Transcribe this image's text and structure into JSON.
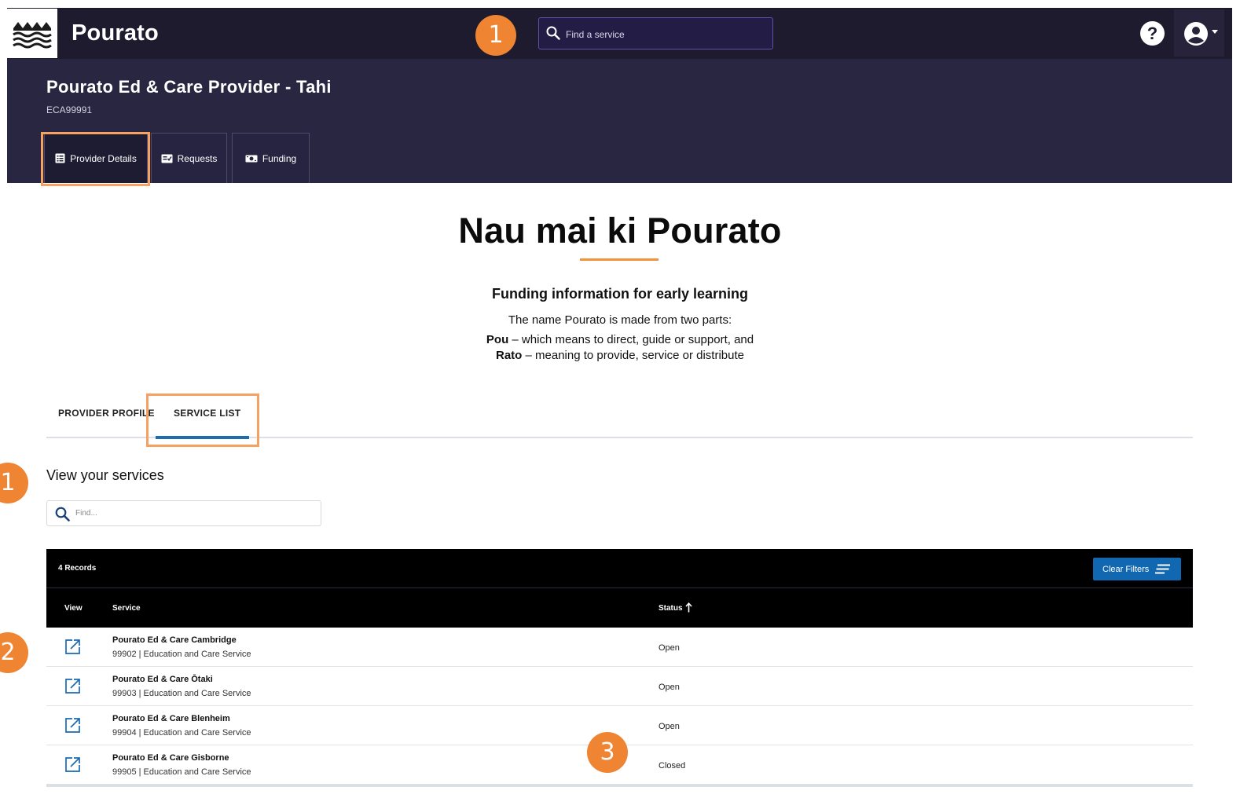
{
  "topbar": {
    "brand": "Pourato",
    "search_placeholder": "Find a service",
    "logo_icon": "waves-icon",
    "help_icon": "help-icon",
    "user_icon": "user-account-icon"
  },
  "provider": {
    "name": "Pourato Ed & Care Provider - Tahi",
    "id": "ECA99991",
    "tabs": [
      {
        "label": "Provider Details",
        "icon": "document-list-icon",
        "active": true
      },
      {
        "label": "Requests",
        "icon": "checklist-icon",
        "active": false
      },
      {
        "label": "Funding",
        "icon": "money-icon",
        "active": false
      }
    ]
  },
  "hero": {
    "title": "Nau mai ki Pourato",
    "subtitle": "Funding information for early learning",
    "intro": "The name Pourato is made from two parts:",
    "line1_bold": "Pou",
    "line1_rest": " – which means to direct, guide or support, and",
    "line2_bold": "Rato",
    "line2_rest": " – meaning to provide, service or distribute"
  },
  "content_tabs": [
    {
      "label": "PROVIDER PROFILE",
      "active": false
    },
    {
      "label": "SERVICE LIST",
      "active": true
    }
  ],
  "services": {
    "title": "View your services",
    "find_placeholder": "Find...",
    "record_count": "4 Records",
    "clear_filters": "Clear Filters",
    "columns": {
      "view": "View",
      "service": "Service",
      "status": "Status"
    },
    "rows": [
      {
        "name": "Pourato Ed & Care Cambridge",
        "desc": "99902 | Education and Care Service",
        "status": "Open"
      },
      {
        "name": "Pourato Ed & Care Ōtaki",
        "desc": "99903 | Education and Care Service",
        "status": "Open"
      },
      {
        "name": "Pourato Ed & Care Blenheim",
        "desc": "99904 | Education and Care Service",
        "status": "Open"
      },
      {
        "name": "Pourato Ed & Care Gisborne",
        "desc": "99905 | Education and Care Service",
        "status": "Closed"
      }
    ]
  },
  "callouts": [
    "1",
    "1",
    "2",
    "3"
  ],
  "colors": {
    "topbar_bg": "#1e1b2e",
    "provider_bg": "#282640",
    "accent_orange": "#ef8432",
    "link_blue": "#1167b0"
  }
}
